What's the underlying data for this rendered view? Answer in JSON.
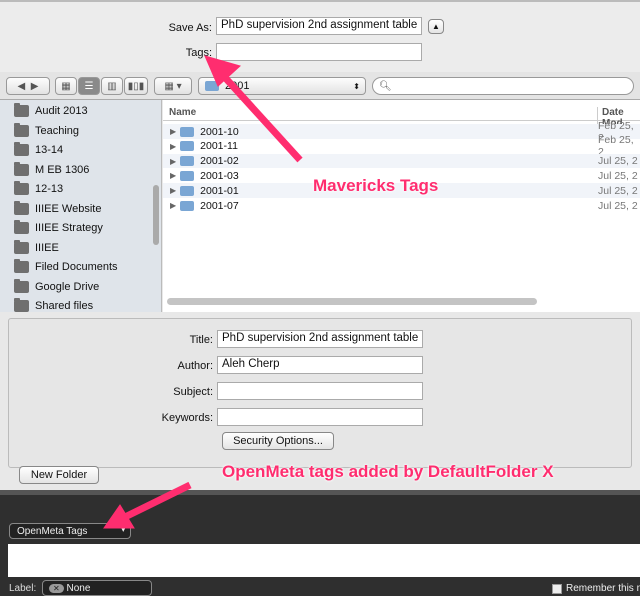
{
  "save_sheet": {
    "save_as_label": "Save As:",
    "save_as_value": "PhD supervision 2nd assignment table",
    "tags_label": "Tags:",
    "tags_value": ""
  },
  "toolbar": {
    "location": "2001",
    "search_placeholder": ""
  },
  "sidebar": {
    "items": [
      "Audit 2013",
      "Teaching",
      "13-14",
      "M EB 1306",
      "12-13",
      "IIIEE Website",
      "IIIEE Strategy",
      "IIIEE",
      "Filed Documents",
      "Google Drive",
      "Shared files"
    ]
  },
  "file_list": {
    "columns": [
      "Name",
      "Date Mod"
    ],
    "rows": [
      {
        "name": "2001-10",
        "date": "Feb 25, 2"
      },
      {
        "name": "2001-11",
        "date": "Feb 25, 2"
      },
      {
        "name": "2001-02",
        "date": "Jul 25, 2"
      },
      {
        "name": "2001-03",
        "date": "Jul 25, 2"
      },
      {
        "name": "2001-01",
        "date": "Jul 25, 2"
      },
      {
        "name": "2001-07",
        "date": "Jul 25, 2"
      }
    ]
  },
  "metadata": {
    "title_label": "Title:",
    "title_value": "PhD supervision 2nd assignment table",
    "author_label": "Author:",
    "author_value": "Aleh Cherp",
    "subject_label": "Subject:",
    "subject_value": "",
    "keywords_label": "Keywords:",
    "keywords_value": "",
    "security_button": "Security Options..."
  },
  "new_folder_button": "New Folder",
  "defaultfolder": {
    "openmeta_select": "OpenMeta Tags",
    "label_label": "Label:",
    "label_value": "None",
    "remember_label": "Remember this n"
  },
  "annotations": {
    "mavericks": "Mavericks Tags",
    "openmeta": "OpenMeta tags added by DefaultFolder X",
    "color": "#ff2d6f"
  }
}
